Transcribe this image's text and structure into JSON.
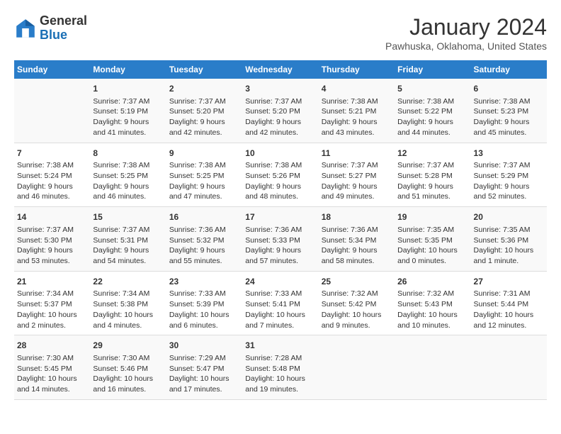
{
  "header": {
    "logo_general": "General",
    "logo_blue": "Blue",
    "month_title": "January 2024",
    "location": "Pawhuska, Oklahoma, United States"
  },
  "days_of_week": [
    "Sunday",
    "Monday",
    "Tuesday",
    "Wednesday",
    "Thursday",
    "Friday",
    "Saturday"
  ],
  "weeks": [
    [
      {
        "day": "",
        "content": ""
      },
      {
        "day": "1",
        "content": "Sunrise: 7:37 AM\nSunset: 5:19 PM\nDaylight: 9 hours\nand 41 minutes."
      },
      {
        "day": "2",
        "content": "Sunrise: 7:37 AM\nSunset: 5:20 PM\nDaylight: 9 hours\nand 42 minutes."
      },
      {
        "day": "3",
        "content": "Sunrise: 7:37 AM\nSunset: 5:20 PM\nDaylight: 9 hours\nand 42 minutes."
      },
      {
        "day": "4",
        "content": "Sunrise: 7:38 AM\nSunset: 5:21 PM\nDaylight: 9 hours\nand 43 minutes."
      },
      {
        "day": "5",
        "content": "Sunrise: 7:38 AM\nSunset: 5:22 PM\nDaylight: 9 hours\nand 44 minutes."
      },
      {
        "day": "6",
        "content": "Sunrise: 7:38 AM\nSunset: 5:23 PM\nDaylight: 9 hours\nand 45 minutes."
      }
    ],
    [
      {
        "day": "7",
        "content": "Sunrise: 7:38 AM\nSunset: 5:24 PM\nDaylight: 9 hours\nand 46 minutes."
      },
      {
        "day": "8",
        "content": "Sunrise: 7:38 AM\nSunset: 5:25 PM\nDaylight: 9 hours\nand 46 minutes."
      },
      {
        "day": "9",
        "content": "Sunrise: 7:38 AM\nSunset: 5:25 PM\nDaylight: 9 hours\nand 47 minutes."
      },
      {
        "day": "10",
        "content": "Sunrise: 7:38 AM\nSunset: 5:26 PM\nDaylight: 9 hours\nand 48 minutes."
      },
      {
        "day": "11",
        "content": "Sunrise: 7:37 AM\nSunset: 5:27 PM\nDaylight: 9 hours\nand 49 minutes."
      },
      {
        "day": "12",
        "content": "Sunrise: 7:37 AM\nSunset: 5:28 PM\nDaylight: 9 hours\nand 51 minutes."
      },
      {
        "day": "13",
        "content": "Sunrise: 7:37 AM\nSunset: 5:29 PM\nDaylight: 9 hours\nand 52 minutes."
      }
    ],
    [
      {
        "day": "14",
        "content": "Sunrise: 7:37 AM\nSunset: 5:30 PM\nDaylight: 9 hours\nand 53 minutes."
      },
      {
        "day": "15",
        "content": "Sunrise: 7:37 AM\nSunset: 5:31 PM\nDaylight: 9 hours\nand 54 minutes."
      },
      {
        "day": "16",
        "content": "Sunrise: 7:36 AM\nSunset: 5:32 PM\nDaylight: 9 hours\nand 55 minutes."
      },
      {
        "day": "17",
        "content": "Sunrise: 7:36 AM\nSunset: 5:33 PM\nDaylight: 9 hours\nand 57 minutes."
      },
      {
        "day": "18",
        "content": "Sunrise: 7:36 AM\nSunset: 5:34 PM\nDaylight: 9 hours\nand 58 minutes."
      },
      {
        "day": "19",
        "content": "Sunrise: 7:35 AM\nSunset: 5:35 PM\nDaylight: 10 hours\nand 0 minutes."
      },
      {
        "day": "20",
        "content": "Sunrise: 7:35 AM\nSunset: 5:36 PM\nDaylight: 10 hours\nand 1 minute."
      }
    ],
    [
      {
        "day": "21",
        "content": "Sunrise: 7:34 AM\nSunset: 5:37 PM\nDaylight: 10 hours\nand 2 minutes."
      },
      {
        "day": "22",
        "content": "Sunrise: 7:34 AM\nSunset: 5:38 PM\nDaylight: 10 hours\nand 4 minutes."
      },
      {
        "day": "23",
        "content": "Sunrise: 7:33 AM\nSunset: 5:39 PM\nDaylight: 10 hours\nand 6 minutes."
      },
      {
        "day": "24",
        "content": "Sunrise: 7:33 AM\nSunset: 5:41 PM\nDaylight: 10 hours\nand 7 minutes."
      },
      {
        "day": "25",
        "content": "Sunrise: 7:32 AM\nSunset: 5:42 PM\nDaylight: 10 hours\nand 9 minutes."
      },
      {
        "day": "26",
        "content": "Sunrise: 7:32 AM\nSunset: 5:43 PM\nDaylight: 10 hours\nand 10 minutes."
      },
      {
        "day": "27",
        "content": "Sunrise: 7:31 AM\nSunset: 5:44 PM\nDaylight: 10 hours\nand 12 minutes."
      }
    ],
    [
      {
        "day": "28",
        "content": "Sunrise: 7:30 AM\nSunset: 5:45 PM\nDaylight: 10 hours\nand 14 minutes."
      },
      {
        "day": "29",
        "content": "Sunrise: 7:30 AM\nSunset: 5:46 PM\nDaylight: 10 hours\nand 16 minutes."
      },
      {
        "day": "30",
        "content": "Sunrise: 7:29 AM\nSunset: 5:47 PM\nDaylight: 10 hours\nand 17 minutes."
      },
      {
        "day": "31",
        "content": "Sunrise: 7:28 AM\nSunset: 5:48 PM\nDaylight: 10 hours\nand 19 minutes."
      },
      {
        "day": "",
        "content": ""
      },
      {
        "day": "",
        "content": ""
      },
      {
        "day": "",
        "content": ""
      }
    ]
  ]
}
